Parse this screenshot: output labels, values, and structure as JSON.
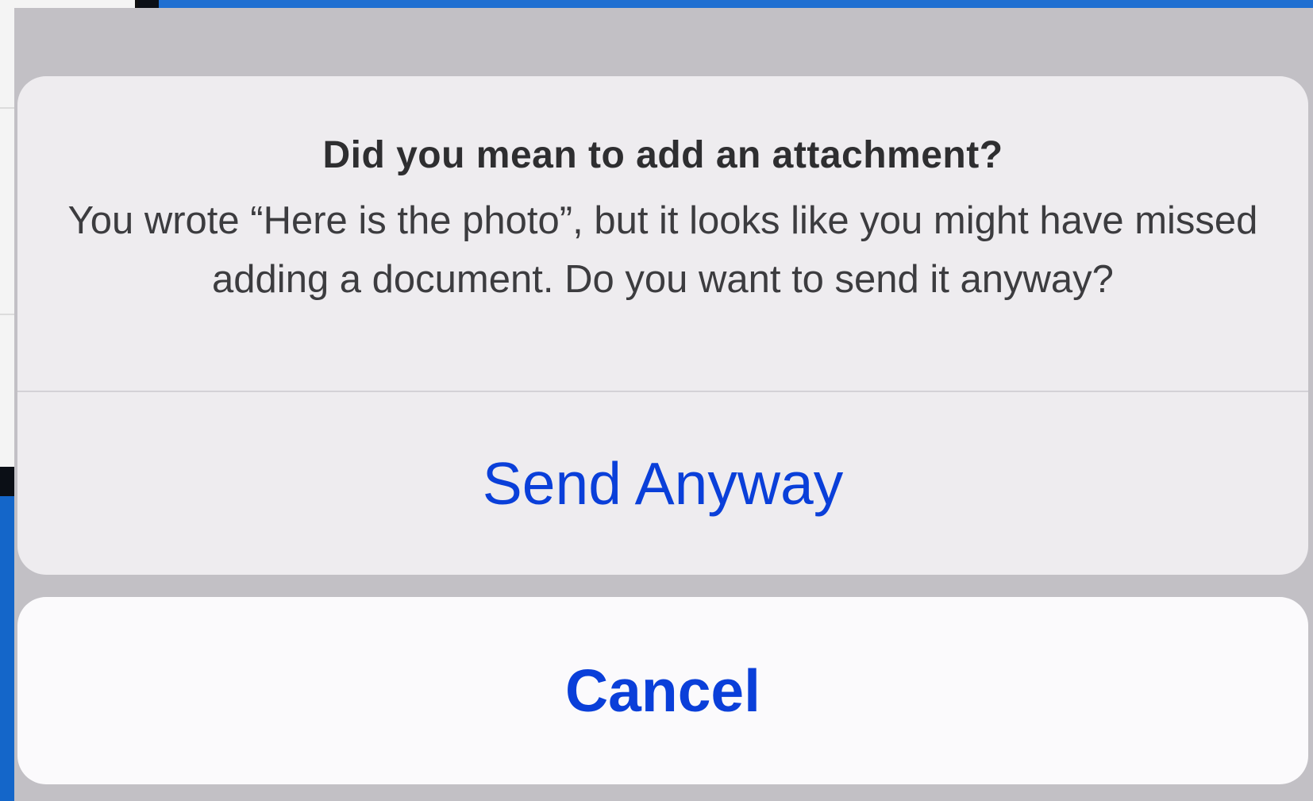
{
  "alert": {
    "title": "Did you mean to add an attachment?",
    "message": "You wrote “Here is the photo”, but it looks like you might have missed adding a document. Do you want to send it anyway?",
    "actions": {
      "send_anyway_label": "Send Anyway",
      "cancel_label": "Cancel"
    }
  },
  "colors": {
    "action_blue": "#0a3fd9",
    "sheet_background": "#eeecef",
    "overlay_dim": "#c2c0c5"
  }
}
